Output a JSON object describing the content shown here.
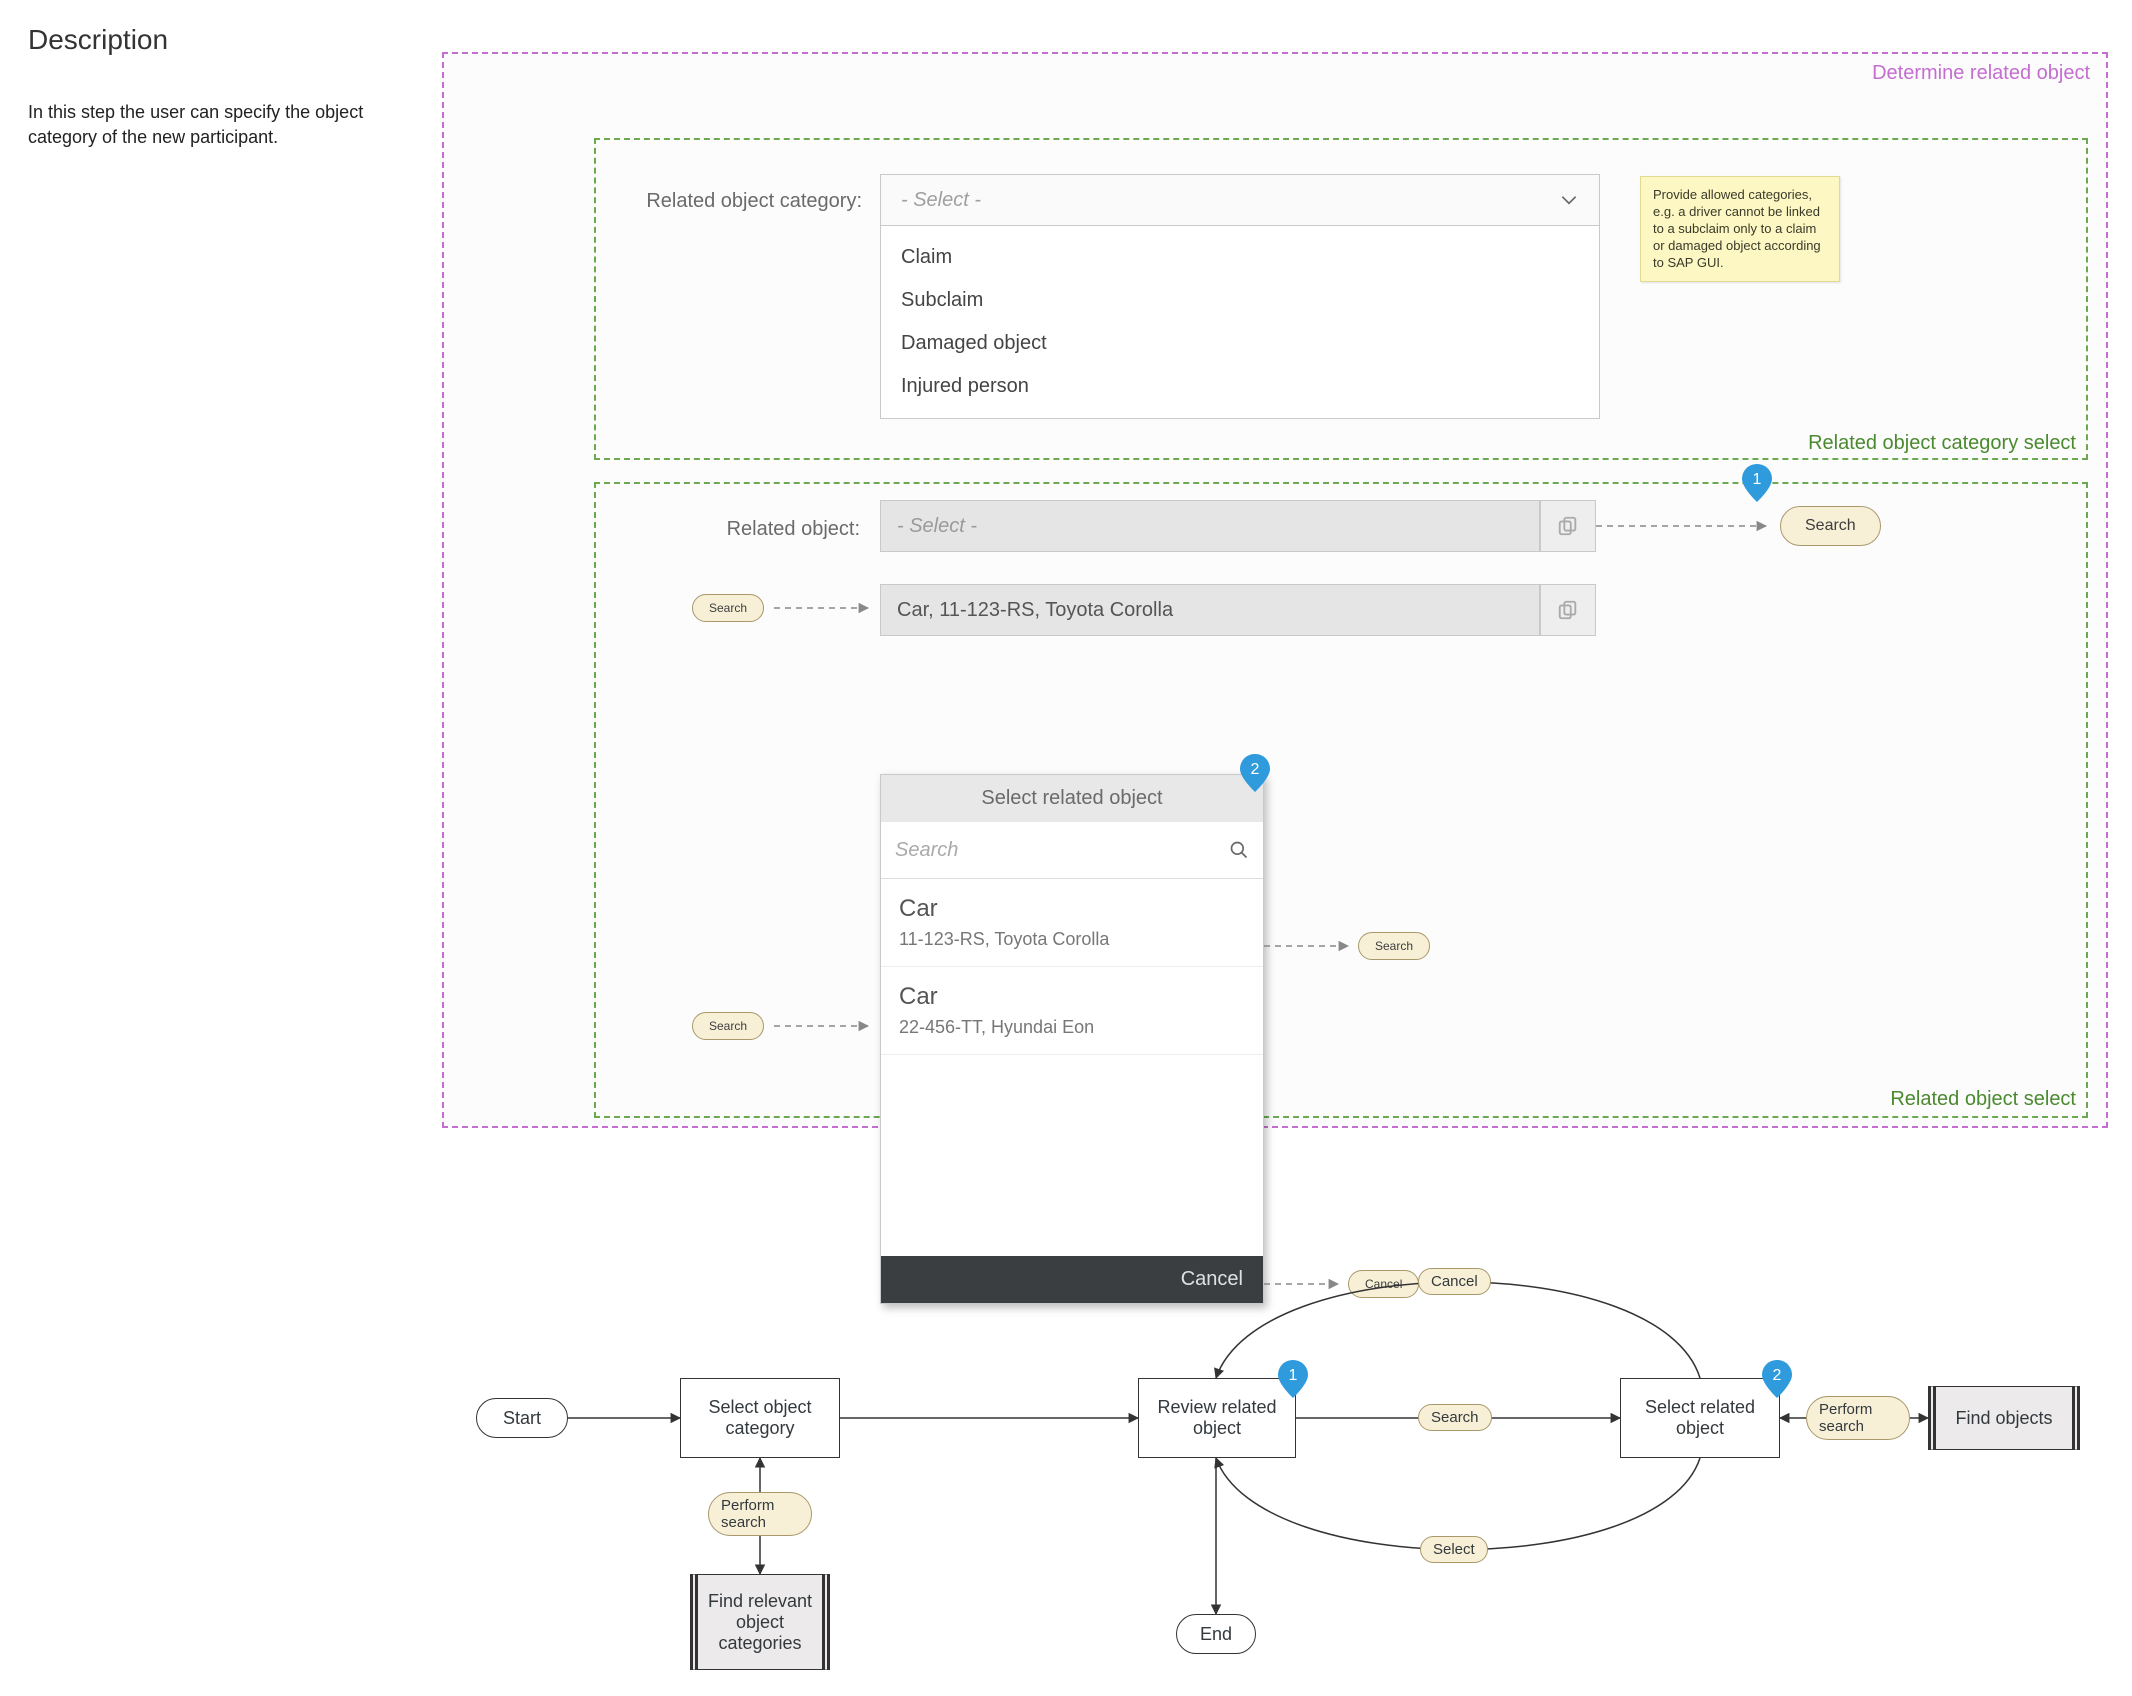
{
  "description": {
    "heading": "Description",
    "body": "In this step the user can specify the object category of the new participant."
  },
  "outer_frame_label": "Determine related object",
  "frames": {
    "category_select_label": "Related object category select",
    "object_select_label": "Related object select"
  },
  "category_field": {
    "label": "Related object category:",
    "placeholder": "- Select -",
    "options": [
      "Claim",
      "Subclaim",
      "Damaged object",
      "Injured person"
    ]
  },
  "sticky": "Provide allowed categories, e.g. a driver cannot be linked to a subclaim only to a claim or damaged object according to SAP GUI.",
  "related_object_field": {
    "label": "Related object:",
    "placeholder": "- Select -",
    "filled_value": "Car, 11-123-RS, Toyota Corolla"
  },
  "pill_labels": {
    "search": "Search",
    "cancel": "Cancel"
  },
  "modal": {
    "title": "Select related object",
    "search_placeholder": "Search",
    "rows": [
      {
        "title": "Car",
        "subtitle": "11-123-RS, Toyota Corolla"
      },
      {
        "title": "Car",
        "subtitle": "22-456-TT, Hyundai Eon"
      }
    ],
    "footer_cancel": "Cancel"
  },
  "markers": {
    "one": "1",
    "two": "2"
  },
  "flow": {
    "start": "Start",
    "end": "End",
    "select_category": "Select object category",
    "review_related": "Review related object",
    "select_related": "Select related object",
    "find_objects": "Find objects",
    "find_relevant": "Find relevant object categories",
    "perform_search": "Perform search",
    "search": "Search",
    "cancel": "Cancel",
    "select": "Select"
  }
}
